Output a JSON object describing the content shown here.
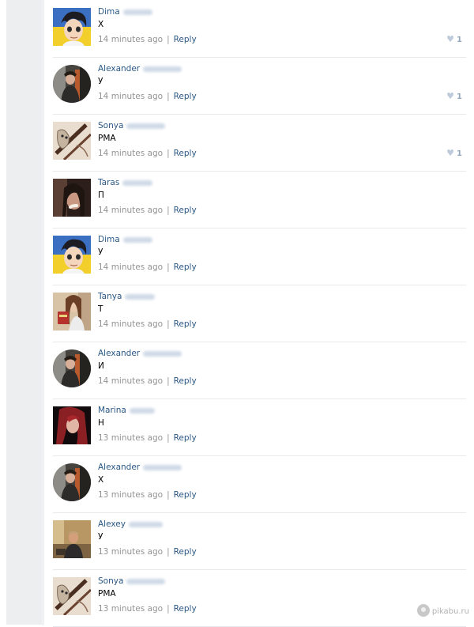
{
  "comments": [
    {
      "first_name": "Dima",
      "last_name": "Glushko",
      "text": "Х",
      "time": "14 minutes ago",
      "reply": "Reply",
      "likes": "1",
      "avatar": "cartoon-boy-ukraine-flag"
    },
    {
      "first_name": "Alexander",
      "last_name": "Yakimchuk",
      "text": "У",
      "time": "14 minutes ago",
      "reply": "Reply",
      "likes": "1",
      "avatar": "man-in-doorway-photo"
    },
    {
      "first_name": "Sonya",
      "last_name": "Vasilyeva",
      "text": "РМА",
      "time": "14 minutes ago",
      "reply": "Reply",
      "likes": "1",
      "avatar": "sketch-cat-photo"
    },
    {
      "first_name": "Taras",
      "last_name": "Kopchak",
      "text": "П",
      "time": "14 minutes ago",
      "reply": "Reply",
      "likes": "",
      "avatar": "girl-face-photo"
    },
    {
      "first_name": "Dima",
      "last_name": "Glushko",
      "text": "У",
      "time": "14 minutes ago",
      "reply": "Reply",
      "likes": "",
      "avatar": "cartoon-boy-ukraine-flag"
    },
    {
      "first_name": "Tanya",
      "last_name": "Volkova",
      "text": "Т",
      "time": "14 minutes ago",
      "reply": "Reply",
      "likes": "",
      "avatar": "girl-with-passport-photo"
    },
    {
      "first_name": "Alexander",
      "last_name": "Yakimchuk",
      "text": "И",
      "time": "14 minutes ago",
      "reply": "Reply",
      "likes": "",
      "avatar": "man-in-doorway-photo"
    },
    {
      "first_name": "Marina",
      "last_name": "Nosova",
      "text": "Н",
      "time": "13 minutes ago",
      "reply": "Reply",
      "likes": "",
      "avatar": "red-haired-girl-photo"
    },
    {
      "first_name": "Alexander",
      "last_name": "Yakimchuk",
      "text": "Х",
      "time": "13 minutes ago",
      "reply": "Reply",
      "likes": "",
      "avatar": "man-in-doorway-photo"
    },
    {
      "first_name": "Alexey",
      "last_name": "Evgrafov",
      "text": "У",
      "time": "13 minutes ago",
      "reply": "Reply",
      "likes": "",
      "avatar": "man-sitting-photo"
    },
    {
      "first_name": "Sonya",
      "last_name": "Vasilyeva",
      "text": "РМА",
      "time": "13 minutes ago",
      "reply": "Reply",
      "likes": "",
      "avatar": "sketch-cat-photo"
    }
  ],
  "watermark": "pikabu.ru",
  "colors": {
    "link": "#2a5885",
    "meta": "#939393",
    "divider": "#e7e8ec",
    "sidebar": "#edeef0",
    "like": "#94a6bb"
  },
  "icons": {
    "like": "heart-icon"
  }
}
